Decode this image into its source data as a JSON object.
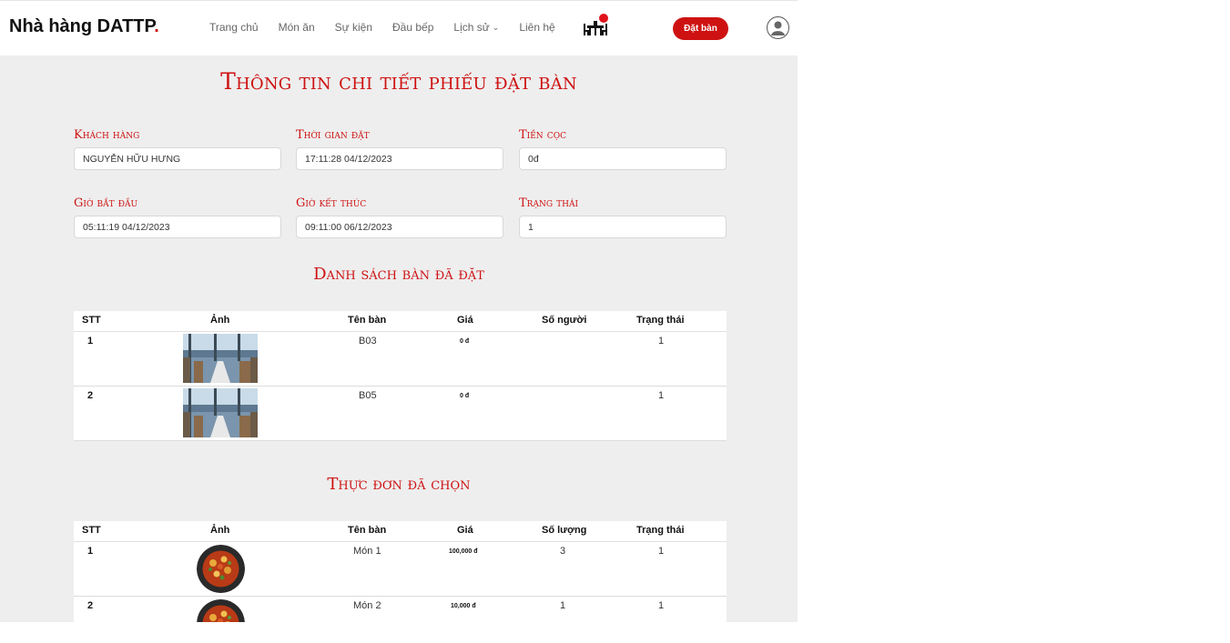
{
  "header": {
    "brand": "Nhà hàng DATTP",
    "brand_dot": ".",
    "nav": [
      "Trang chủ",
      "Món ăn",
      "Sự kiện",
      "Đầu bếp",
      "Lịch sử",
      "Liên hệ"
    ],
    "nav_dropdown_icon": "chevron-down-icon",
    "book_label": "Đặt bàn",
    "cart_icon": "dining-table-icon",
    "avatar_icon": "user-icon",
    "accent": "#ce1212"
  },
  "page": {
    "title": "Thông tin chi tiết phiếu đặt bàn",
    "fields": [
      {
        "label": "Khách hàng",
        "value": "NGUYỄN HỮU HƯNG"
      },
      {
        "label": "Thời gian đặt",
        "value": "17:11:28 04/12/2023"
      },
      {
        "label": "Tiền cọc",
        "value": "0đ"
      },
      {
        "label": "Giờ bắt đầu",
        "value": "05:11:19 04/12/2023"
      },
      {
        "label": "Giờ kết thúc",
        "value": "09:11:00 06/12/2023"
      },
      {
        "label": "Trạng thái",
        "value": "1"
      }
    ]
  },
  "tables_section": {
    "title": "Danh sách bàn đã đặt",
    "headers": [
      "STT",
      "Ảnh",
      "Tên bàn",
      "Giá",
      "Số người",
      "Trạng thái"
    ],
    "rows": [
      {
        "stt": "1",
        "name": "B03",
        "price": "0 đ",
        "people": "",
        "status": "1"
      },
      {
        "stt": "2",
        "name": "B05",
        "price": "0 đ",
        "people": "",
        "status": "1"
      }
    ]
  },
  "menu_section": {
    "title": "Thực đơn đã chọn",
    "headers": [
      "STT",
      "Ảnh",
      "Tên bàn",
      "Giá",
      "Số lượng",
      "Trạng thái"
    ],
    "rows": [
      {
        "stt": "1",
        "name": "Món 1",
        "price": "100,000 đ",
        "qty": "3",
        "status": "1"
      },
      {
        "stt": "2",
        "name": "Món 2",
        "price": "10,000 đ",
        "qty": "1",
        "status": "1"
      }
    ]
  }
}
